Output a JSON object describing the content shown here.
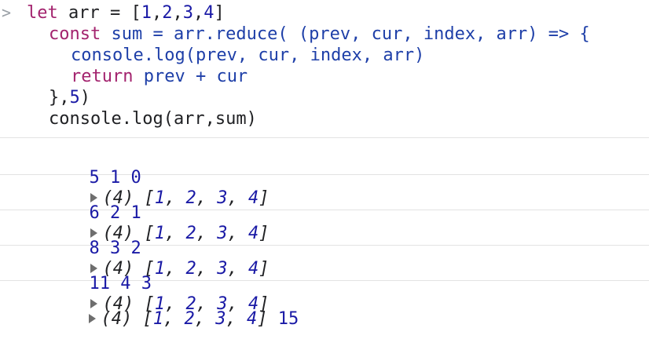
{
  "prompt_symbol": ">",
  "code": {
    "line1": {
      "kw": "let",
      "rest": " arr = [",
      "n1": "1",
      "c1": ",",
      "n2": "2",
      "c2": ",",
      "n3": "3",
      "c3": ",",
      "n4": "4",
      "end": "]"
    },
    "line2": {
      "kw": "const",
      "rest": " sum = arr.reduce( (prev, cur, index, arr) => {"
    },
    "line3": {
      "text": "console.log(prev, cur, index, arr)"
    },
    "line4": {
      "kw": "return",
      "rest": " prev + cur"
    },
    "line5": {
      "pre": "},",
      "num": "5",
      "post": ")"
    },
    "line6": {
      "text": "console.log(arr,sum)"
    }
  },
  "logs": [
    {
      "prefix": "5 1 0",
      "count": "(4) ",
      "open": "[",
      "items": [
        "1",
        "2",
        "3",
        "4"
      ],
      "close": "]"
    },
    {
      "prefix": "6 2 1",
      "count": "(4) ",
      "open": "[",
      "items": [
        "1",
        "2",
        "3",
        "4"
      ],
      "close": "]"
    },
    {
      "prefix": "8 3 2",
      "count": "(4) ",
      "open": "[",
      "items": [
        "1",
        "2",
        "3",
        "4"
      ],
      "close": "]"
    },
    {
      "prefix": "11 4 3",
      "count": "(4) ",
      "open": "[",
      "items": [
        "1",
        "2",
        "3",
        "4"
      ],
      "close": "]"
    }
  ],
  "final_log": {
    "count": "(4) ",
    "open": "[",
    "items": [
      "1",
      "2",
      "3",
      "4"
    ],
    "close": "]",
    "sum": "15"
  },
  "colors": {
    "keyword": "#a3236e",
    "number": "#1a1aa6",
    "text": "#202124",
    "divider": "#e3e3e3"
  }
}
